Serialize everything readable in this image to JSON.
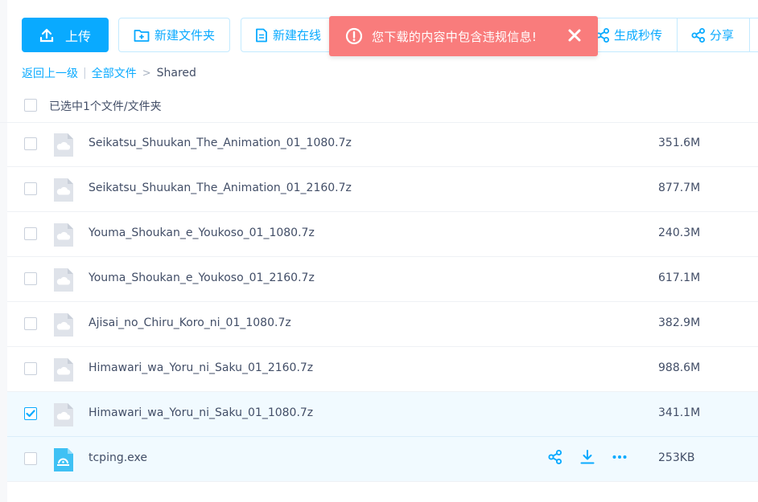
{
  "toolbar": {
    "upload_label": "上传",
    "new_folder_label": "新建文件夹",
    "new_online_label": "新建在线",
    "miaochuan_label": "生成秒传",
    "share_label": "分享"
  },
  "toast": {
    "message": "您下载的内容中包含违规信息!",
    "color": "#f97c7c"
  },
  "breadcrumb": {
    "back": "返回上一级",
    "separator": "|",
    "all_files": "全部文件",
    "arrow": ">",
    "current": "Shared"
  },
  "selection": {
    "label": "已选中1个文件/文件夹"
  },
  "colors": {
    "accent": "#09aaff",
    "text": "#424e67",
    "selected_row": "#f1faff"
  },
  "files": [
    {
      "name": "Seikatsu_Shuukan_The_Animation_01_1080.7z",
      "size": "351.6M",
      "checked": false,
      "icon": "archive-cloud-icon"
    },
    {
      "name": "Seikatsu_Shuukan_The_Animation_01_2160.7z",
      "size": "877.7M",
      "checked": false,
      "icon": "archive-cloud-icon"
    },
    {
      "name": "Youma_Shoukan_e_Youkoso_01_1080.7z",
      "size": "240.3M",
      "checked": false,
      "icon": "archive-cloud-icon"
    },
    {
      "name": "Youma_Shoukan_e_Youkoso_01_2160.7z",
      "size": "617.1M",
      "checked": false,
      "icon": "archive-cloud-icon"
    },
    {
      "name": "Ajisai_no_Chiru_Koro_ni_01_1080.7z",
      "size": "382.9M",
      "checked": false,
      "icon": "archive-cloud-icon"
    },
    {
      "name": "Himawari_wa_Yoru_ni_Saku_01_2160.7z",
      "size": "988.6M",
      "checked": false,
      "icon": "archive-cloud-icon"
    },
    {
      "name": "Himawari_wa_Yoru_ni_Saku_01_1080.7z",
      "size": "341.1M",
      "checked": true,
      "icon": "archive-cloud-icon"
    },
    {
      "name": "tcping.exe",
      "size": "253KB",
      "checked": false,
      "icon": "exe-file-icon"
    }
  ]
}
